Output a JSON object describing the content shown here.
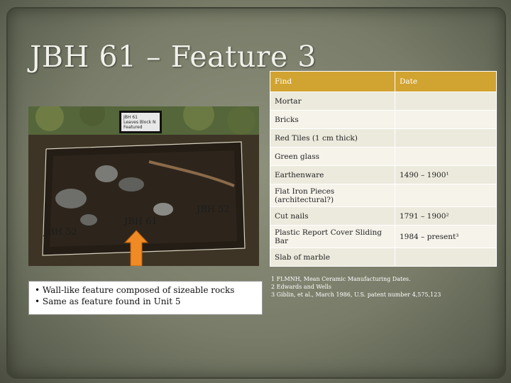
{
  "title": "JBH 61 – Feature 3",
  "photo": {
    "sign_text": [
      "JBH 61",
      "Leaves Block N",
      "Featured"
    ],
    "labels": {
      "jbh52_left": "JBH 52",
      "jbh61": "JBH 61",
      "jbh52_right": "JBH 52"
    }
  },
  "bullets": [
    "• Wall-like feature composed of sizeable rocks",
    "• Same as feature found in Unit 5"
  ],
  "table": {
    "headers": {
      "find": "Find",
      "date": "Date"
    },
    "rows": [
      {
        "find": "Mortar",
        "date": "",
        "height": 26
      },
      {
        "find": "Bricks",
        "date": "",
        "height": 26
      },
      {
        "find": "Red Tiles (1 cm thick)",
        "date": "",
        "height": 26
      },
      {
        "find": "Green glass",
        "date": "",
        "height": 26
      },
      {
        "find": "Earthenware",
        "date": "1490 – 1900¹",
        "height": 26
      },
      {
        "find": "Flat Iron Pieces (architectural?)",
        "date": "",
        "height": 32
      },
      {
        "find": "Cut nails",
        "date": "1791 – 1900²",
        "height": 26
      },
      {
        "find": "Plastic Report Cover Sliding Bar",
        "date": "1984 – present³",
        "height": 32,
        "date_color": "red"
      },
      {
        "find": "Slab of marble",
        "date": "",
        "height": 26
      }
    ]
  },
  "footnotes": [
    "1 FLMNH, Mean Ceramic Manufacturing Dates.",
    "2 Edwards and Wells",
    "3 Giblin, et al., March 1986, U.S. patent number 4,575,123"
  ],
  "colors": {
    "header": "#d1a330",
    "title": "#f1f1ea",
    "red_date": "#b21e16"
  }
}
